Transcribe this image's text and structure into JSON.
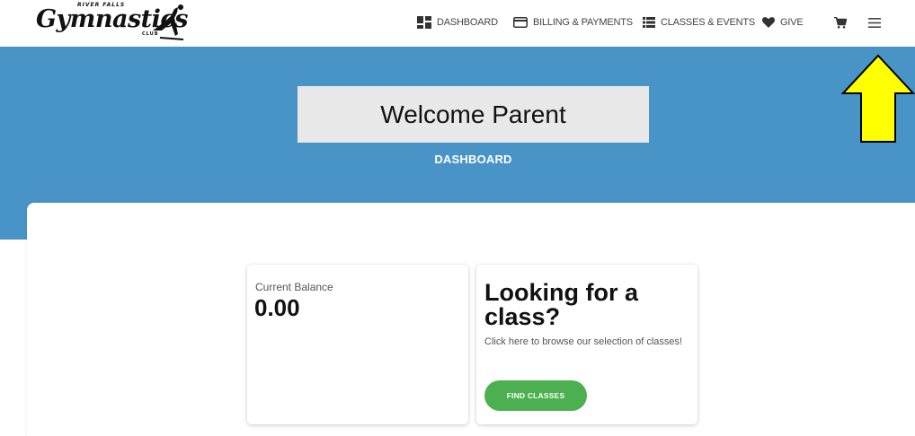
{
  "brand": {
    "top": "RIVER FALLS",
    "main": "Gymnastics",
    "bottom": "CLUB"
  },
  "nav": {
    "dashboard": "DASHBOARD",
    "billing": "BILLING & PAYMENTS",
    "classes": "CLASSES & EVENTS",
    "give": "GIVE",
    "icons": [
      "dashboard-icon",
      "credit-card-icon",
      "list-icon",
      "heart-icon",
      "cart-icon",
      "menu-icon"
    ]
  },
  "banner": {
    "welcome": "Welcome Parent",
    "subtitle": "DASHBOARD"
  },
  "balance_card": {
    "label": "Current Balance",
    "value": "0.00"
  },
  "class_card": {
    "title": "Looking for a class?",
    "description": "Click here to browse our selection of classes!",
    "button": "FIND CLASSES"
  },
  "colors": {
    "banner": "#4894c7",
    "button": "#4caf50",
    "arrow": "#ffff00"
  }
}
